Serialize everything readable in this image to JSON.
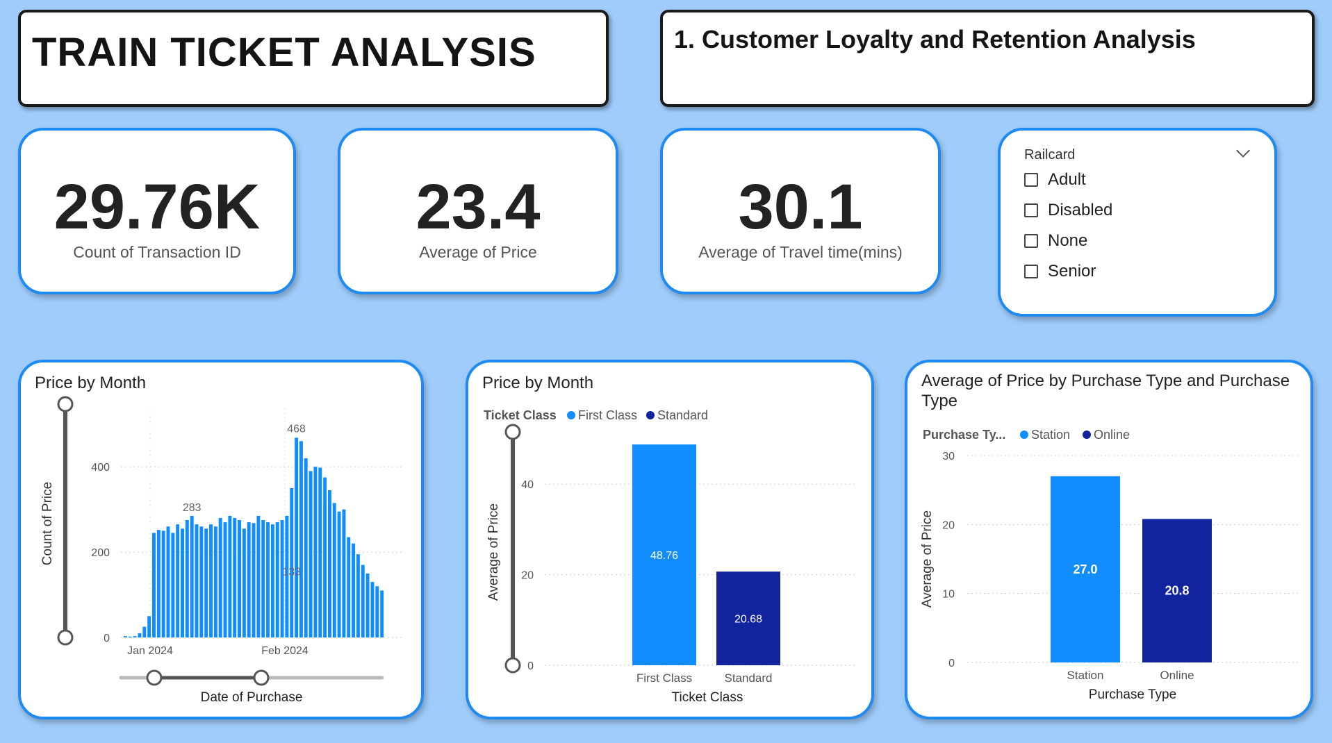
{
  "header": {
    "title": "TRAIN TICKET ANALYSIS",
    "subtitle": "1. Customer Loyalty and Retention Analysis"
  },
  "kpis": [
    {
      "value": "29.76K",
      "label": "Count of Transaction ID"
    },
    {
      "value": "23.4",
      "label": "Average of Price"
    },
    {
      "value": "30.1",
      "label": "Average of Travel time(mins)"
    }
  ],
  "slicer": {
    "title": "Railcard",
    "items": [
      "Adult",
      "Disabled",
      "None",
      "Senior"
    ]
  },
  "colors": {
    "background": "#9fccfb",
    "accent": "#1f8bf0",
    "light_blue": "#118dff",
    "dark_blue": "#12239e"
  },
  "chart_data": [
    {
      "type": "bar",
      "title": "Price by Month",
      "xlabel": "Date of Purchase",
      "ylabel": "Count of Price",
      "x_ticks": [
        "Jan 2024",
        "Feb 2024"
      ],
      "y_ticks": [
        0,
        200,
        400
      ],
      "ylim": [
        0,
        550
      ],
      "values": [
        3,
        2,
        3,
        10,
        25,
        50,
        245,
        252,
        250,
        260,
        245,
        265,
        255,
        275,
        285,
        265,
        260,
        255,
        265,
        260,
        280,
        270,
        285,
        280,
        275,
        255,
        270,
        268,
        285,
        275,
        270,
        265,
        270,
        275,
        285,
        350,
        468,
        460,
        420,
        390,
        400,
        398,
        375,
        345,
        315,
        295,
        300,
        235,
        220,
        195,
        170,
        150,
        130,
        120,
        110
      ],
      "data_labels": [
        {
          "text": "283",
          "index": 14
        },
        {
          "text": "468",
          "index": 36
        },
        {
          "text": "133",
          "index": 35
        }
      ],
      "grid": true
    },
    {
      "type": "bar",
      "title": "Price by Month",
      "legend_title": "Ticket Class",
      "legend": "top-left",
      "xlabel": "Ticket Class",
      "ylabel": "Average of Price",
      "categories": [
        "First Class",
        "Standard"
      ],
      "series": [
        {
          "name": "First Class",
          "values": [
            48.76,
            null
          ]
        },
        {
          "name": "Standard",
          "values": [
            null,
            20.68
          ]
        }
      ],
      "value_labels": [
        "48.76",
        "20.68"
      ],
      "y_ticks": [
        0,
        20,
        40
      ],
      "ylim": [
        0,
        50
      ],
      "grid": true
    },
    {
      "type": "bar",
      "title": "Average of Price by Purchase Type and Purchase Type",
      "legend_title": "Purchase Ty...",
      "legend": "top-left",
      "xlabel": "Purchase Type",
      "ylabel": "Average of Price",
      "categories": [
        "Station",
        "Online"
      ],
      "series": [
        {
          "name": "Station",
          "values": [
            27.0,
            null
          ]
        },
        {
          "name": "Online",
          "values": [
            null,
            20.8
          ]
        }
      ],
      "value_labels": [
        "27.0",
        "20.8"
      ],
      "y_ticks": [
        0,
        10,
        20,
        30
      ],
      "ylim": [
        0,
        30
      ],
      "grid": true
    }
  ]
}
